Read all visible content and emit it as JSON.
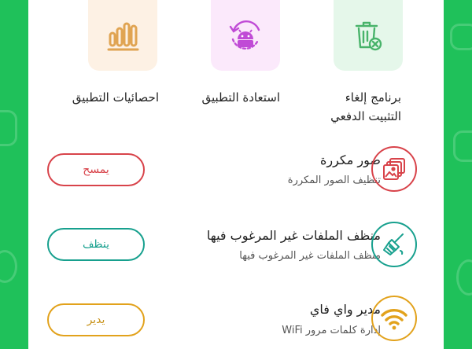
{
  "tools": [
    {
      "label": "احصائيات التطبيق",
      "icon": "bar-chart-icon",
      "color": "#e0a452",
      "bg": "#fdf1e4"
    },
    {
      "label": "استعادة التطبيق",
      "icon": "android-restore-icon",
      "color": "#c04bd6",
      "bg": "#fbe9fb"
    },
    {
      "label_line1": "برنامج إلغاء",
      "label_line2": "التثبيت الدفعي",
      "icon": "trash-uninstall-icon",
      "color": "#48b36a",
      "bg": "#e5f7ea"
    }
  ],
  "features": [
    {
      "title": "صور مكررة",
      "subtitle": "تنظيف الصور المكررة",
      "button": "يمسح",
      "icon": "duplicate-photos-icon",
      "color": "#d8434a"
    },
    {
      "title": "منظف الملفات غير المرغوب فيها",
      "subtitle": "منظف الملفات غير المرغوب فيها",
      "button": "ينظف",
      "icon": "broom-icon",
      "color": "#17a08e"
    },
    {
      "title": "مدير واي فاي",
      "subtitle": "إدارة كلمات مرور WiFi",
      "button": "يدير",
      "icon": "wifi-icon",
      "color": "#e2a21c"
    }
  ]
}
